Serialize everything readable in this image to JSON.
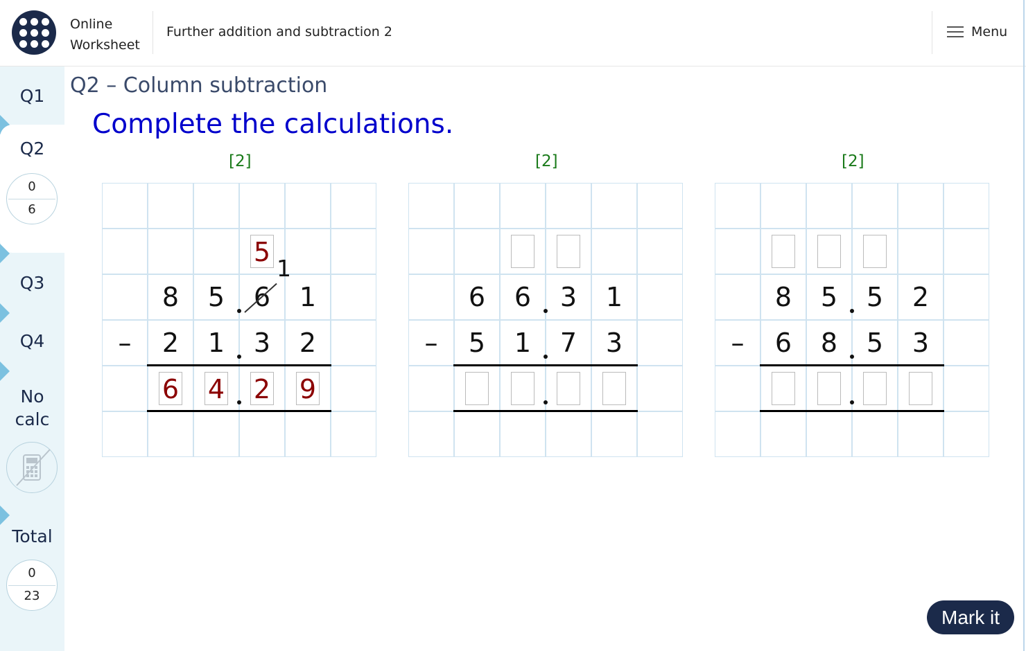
{
  "header": {
    "brand_line1": "Online",
    "brand_line2": "Worksheet",
    "topic": "Further addition and subtraction 2",
    "menu_label": "Menu"
  },
  "sidebar": {
    "q1": "Q1",
    "q2": "Q2",
    "q2_score": "0",
    "q2_total": "6",
    "q3": "Q3",
    "q4": "Q4",
    "nocalc_line1": "No",
    "nocalc_line2": "calc",
    "total_label": "Total",
    "total_score": "0",
    "total_max": "23"
  },
  "question": {
    "title": "Q2 – Column subtraction",
    "instruction": "Complete the calculations."
  },
  "problems": [
    {
      "marks": "[2]",
      "carry_boxes": [
        "",
        "",
        "5",
        ""
      ],
      "carry_digit": "1",
      "top": [
        "8",
        "5",
        "6",
        "1"
      ],
      "operator": "–",
      "bottom": [
        "2",
        "1",
        "3",
        "2"
      ],
      "answer": [
        "6",
        "4",
        "2",
        "9"
      ]
    },
    {
      "marks": "[2]",
      "carry_boxes": [
        "",
        "",
        "",
        ""
      ],
      "top": [
        "6",
        "6",
        "3",
        "1"
      ],
      "operator": "–",
      "bottom": [
        "5",
        "1",
        "7",
        "3"
      ],
      "answer": [
        "",
        "",
        "",
        ""
      ]
    },
    {
      "marks": "[2]",
      "carry_boxes": [
        "",
        "",
        "",
        ""
      ],
      "top": [
        "8",
        "5",
        "5",
        "2"
      ],
      "operator": "–",
      "bottom": [
        "6",
        "8",
        "5",
        "3"
      ],
      "answer": [
        "",
        "",
        "",
        ""
      ]
    }
  ],
  "actions": {
    "mark_it": "Mark it"
  }
}
